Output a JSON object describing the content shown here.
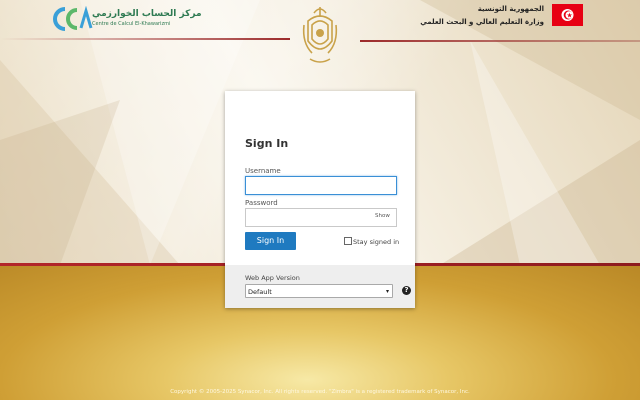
{
  "header": {
    "logo_arabic": "مركز الحساب الخوارزمي",
    "logo_latin": "Centre de Calcul El-Khawarizmi",
    "gov_line1": "الجمهورية التونسية",
    "gov_line2": "وزارة التعليم العالي و البحث العلمي"
  },
  "login": {
    "title": "Sign In",
    "username_label": "Username",
    "username_value": "",
    "password_label": "Password",
    "password_value": "",
    "show_label": "Show",
    "signin_label": "Sign In",
    "stay_signed_in_label": "Stay signed in",
    "stay_signed_in_checked": false
  },
  "version": {
    "label": "Web App Version",
    "selected": "Default",
    "help_glyph": "?"
  },
  "footer": {
    "copyright": "Copyright © 2005-2025 Synacor, Inc. All rights reserved. \"Zimbra\" is a registered trademark of Synacor, Inc."
  },
  "colors": {
    "accent": "#1f7ac0",
    "focus": "#3a8fd6",
    "flag_red": "#e70013",
    "band_red": "#b3262a",
    "gold": "#cf9f35"
  },
  "icons": {
    "logo": "ccak-logo",
    "emblem": "tunisia-coat-of-arms-icon",
    "flag": "tunisia-flag-icon",
    "help": "help-icon",
    "select_arrow": "chevron-down-icon"
  }
}
